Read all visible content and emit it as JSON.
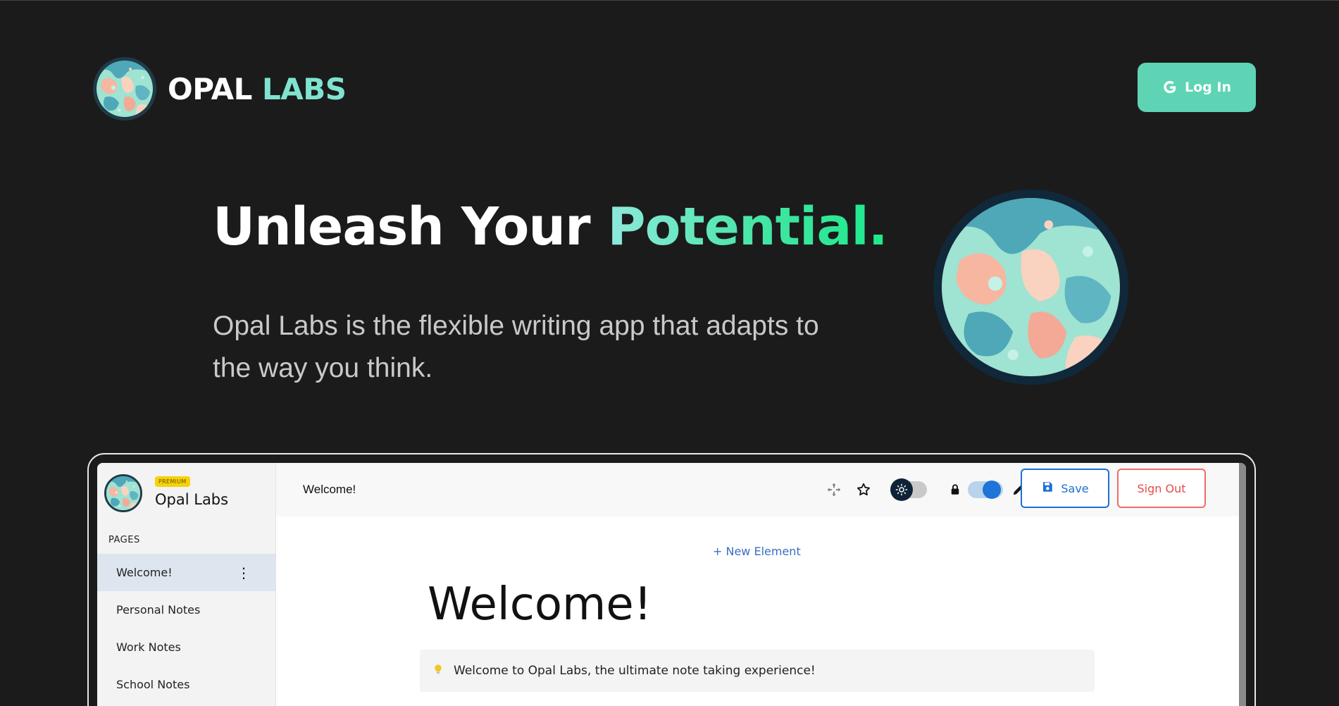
{
  "brand": {
    "name_part1": "OPAL",
    "name_part2": "LABS"
  },
  "header": {
    "login_label": "Log In"
  },
  "hero": {
    "title_part1": "Unleash Your ",
    "title_accent": "Potential.",
    "subtitle": "Opal Labs is the flexible writing app that adapts to the way you think."
  },
  "app": {
    "sidebar": {
      "badge": "PREMIUM",
      "title": "Opal Labs",
      "section_label": "PAGES",
      "items": [
        {
          "label": "Welcome!",
          "active": true
        },
        {
          "label": "Personal Notes"
        },
        {
          "label": "Work Notes"
        },
        {
          "label": "School Notes"
        }
      ]
    },
    "topbar": {
      "breadcrumb": "Welcome!",
      "save_label": "Save",
      "signout_label": "Sign Out"
    },
    "editor": {
      "new_element_label": "+ New Element",
      "heading": "Welcome!",
      "callout_text": "Welcome to Opal Labs, the ultimate note taking experience!"
    }
  },
  "colors": {
    "background": "#1b1b1c",
    "accent": "#5ed4b4",
    "save_blue": "#1e6fd0",
    "signout_red": "#e24d4d"
  },
  "icons": [
    "google-icon",
    "move-icon",
    "star-icon",
    "sun-icon",
    "lock-icon",
    "pencil-icon",
    "save-icon",
    "lightbulb-icon",
    "kebab-menu-icon"
  ]
}
